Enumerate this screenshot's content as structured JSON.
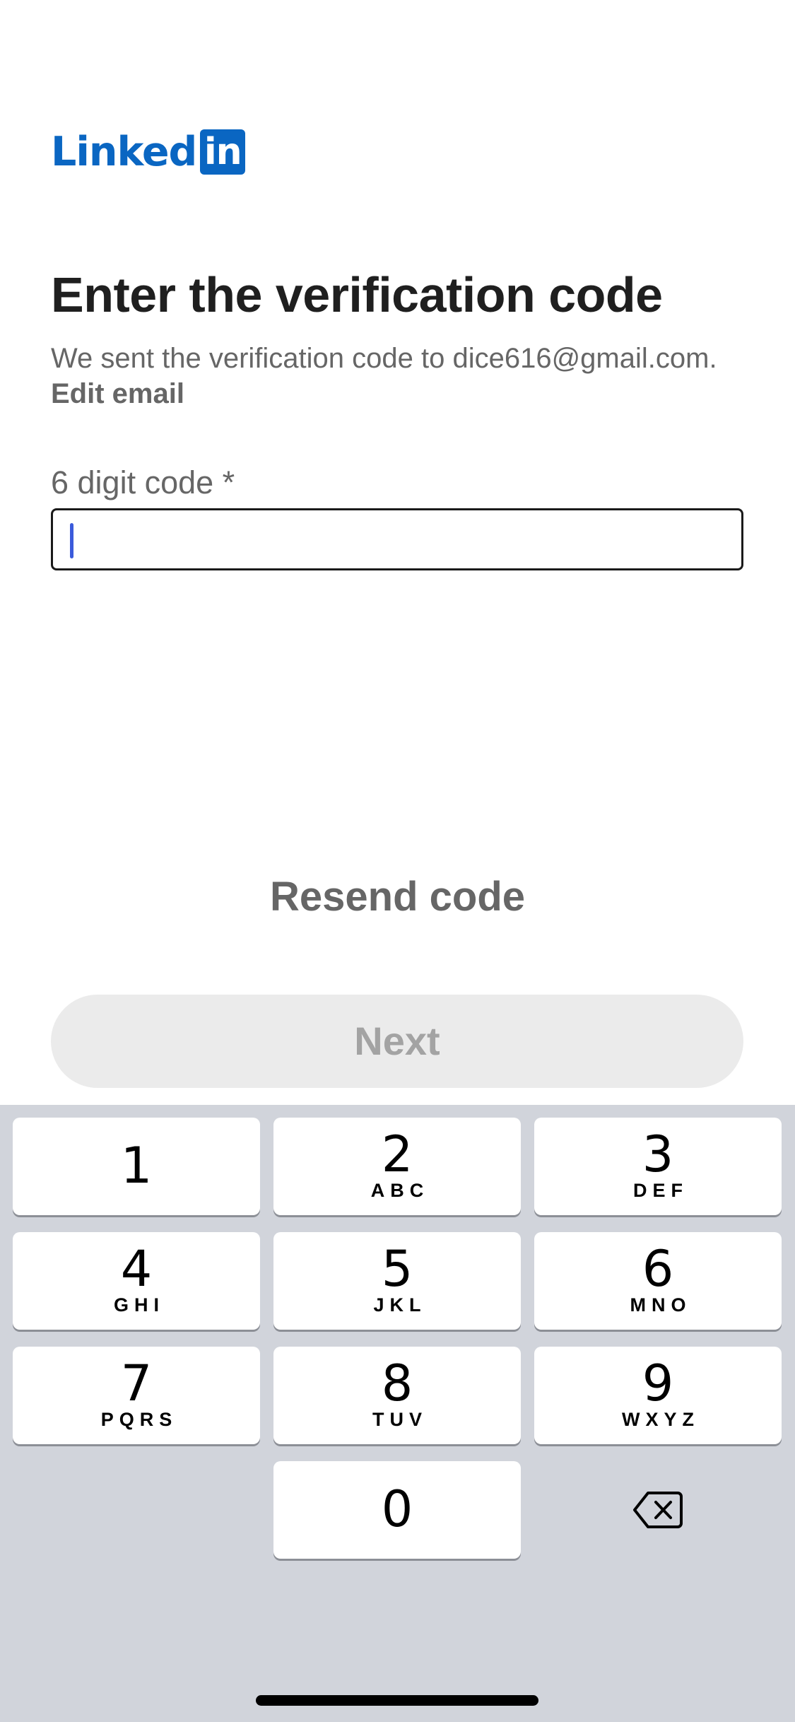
{
  "logo": {
    "word": "Linked",
    "box": "in"
  },
  "page": {
    "title": "Enter the verification code",
    "description": "We sent the verification code to dice616@gmail.com. ",
    "edit_email_label": "Edit email",
    "field_label": "6 digit code *",
    "input_value": "",
    "resend_label": "Resend code",
    "next_label": "Next"
  },
  "keyboard": {
    "keys": [
      {
        "digit": "1",
        "letters": ""
      },
      {
        "digit": "2",
        "letters": "ABC"
      },
      {
        "digit": "3",
        "letters": "DEF"
      },
      {
        "digit": "4",
        "letters": "GHI"
      },
      {
        "digit": "5",
        "letters": "JKL"
      },
      {
        "digit": "6",
        "letters": "MNO"
      },
      {
        "digit": "7",
        "letters": "PQRS"
      },
      {
        "digit": "8",
        "letters": "TUV"
      },
      {
        "digit": "9",
        "letters": "WXYZ"
      },
      {
        "digit": "0",
        "letters": ""
      }
    ],
    "backspace_icon": "backspace-icon"
  },
  "colors": {
    "brand": "#0a66c2",
    "caret": "#3b5bdb",
    "next_bg": "#ebebeb",
    "keyboard_bg": "#d1d4db"
  }
}
